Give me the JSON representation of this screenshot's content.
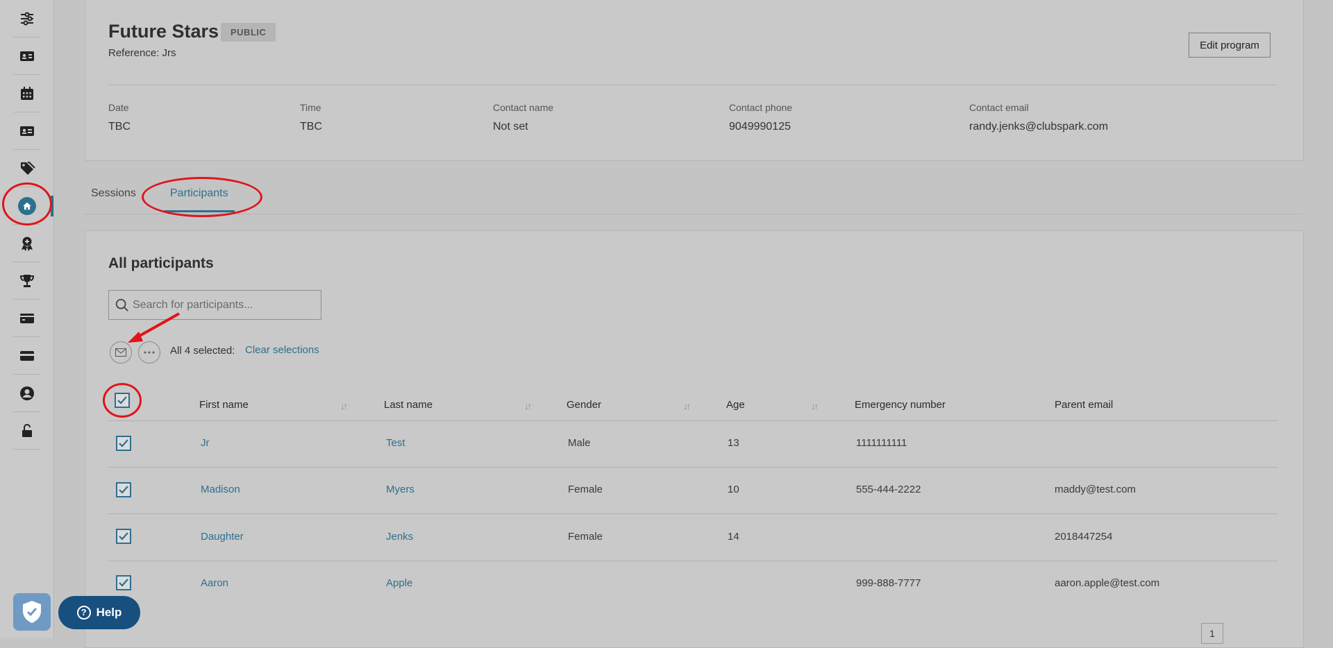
{
  "sidebar": {
    "items": [
      {
        "icon": "sliders-icon",
        "label": ""
      },
      {
        "icon": "id-card-icon",
        "label": ""
      },
      {
        "icon": "calendar-icon",
        "label": ""
      },
      {
        "icon": "contact-card-icon",
        "label": ""
      },
      {
        "icon": "tags-icon",
        "label": ""
      },
      {
        "icon": "home-icon",
        "label": "",
        "active": true
      },
      {
        "icon": "award-icon",
        "label": ""
      },
      {
        "icon": "trophy-icon",
        "label": ""
      },
      {
        "icon": "ticket-icon",
        "label": ""
      },
      {
        "icon": "credit-card-icon",
        "label": ""
      },
      {
        "icon": "user-icon",
        "label": ""
      },
      {
        "icon": "unlock-icon",
        "label": ""
      }
    ]
  },
  "program": {
    "title": "Future Stars",
    "visibility_badge": "PUBLIC",
    "reference": "Reference: Jrs",
    "edit_label": "Edit program",
    "details": [
      {
        "label": "Date",
        "value": "TBC"
      },
      {
        "label": "Time",
        "value": "TBC"
      },
      {
        "label": "Contact name",
        "value": "Not set"
      },
      {
        "label": "Contact phone",
        "value": "9049990125"
      },
      {
        "label": "Contact email",
        "value": "randy.jenks@clubspark.com"
      }
    ]
  },
  "tabs": [
    {
      "label": "Sessions",
      "active": false
    },
    {
      "label": "Participants",
      "active": true
    }
  ],
  "participants": {
    "section_title": "All participants",
    "search_placeholder": "Search for participants...",
    "selected_text": "All 4 selected:",
    "clear_label": "Clear selections",
    "columns": [
      "First name",
      "Last name",
      "Gender",
      "Age",
      "Emergency number",
      "Parent email"
    ],
    "rows": [
      {
        "first": "Jr",
        "last": "Test",
        "gender": "Male",
        "age": "13",
        "emergency": "1111111111",
        "parent_email": "",
        "checked": true
      },
      {
        "first": "Madison",
        "last": "Myers",
        "gender": "Female",
        "age": "10",
        "emergency": "555-444-2222",
        "parent_email": "maddy@test.com",
        "checked": true
      },
      {
        "first": "Daughter",
        "last": "Jenks",
        "gender": "Female",
        "age": "14",
        "emergency": "",
        "parent_email": "2018447254",
        "checked": true
      },
      {
        "first": "Aaron",
        "last": "Apple",
        "gender": "",
        "age": "",
        "emergency": "999-888-7777",
        "parent_email": "aaron.apple@test.com",
        "checked": true
      }
    ],
    "current_page": "1"
  },
  "help": {
    "label": "Help"
  },
  "colors": {
    "accent": "#2e6f8e",
    "annotation": "#e0141b",
    "help_bg": "#174f7e"
  }
}
